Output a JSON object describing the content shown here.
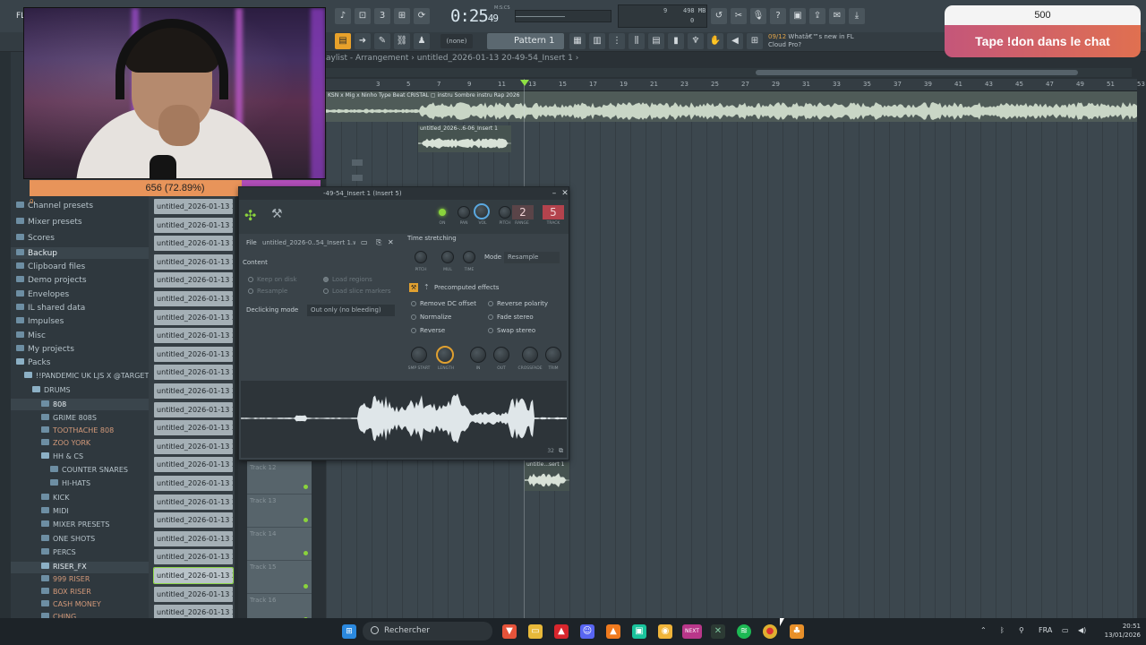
{
  "topbar": {
    "app_label": "FL",
    "time": "0:25",
    "time_small": "49",
    "time_unit": "M:S:CS",
    "cpu": {
      "top_left": "9",
      "top_right": "498 MB",
      "bottom_right": "0"
    },
    "pattern_none": "(none)",
    "pattern": "Pattern 1",
    "news": {
      "date": "09/12",
      "line1": "Whatâ€™s new in FL",
      "line2": "Cloud Pro?"
    }
  },
  "donation": {
    "amount": "500",
    "message": "Tape !don dans le chat"
  },
  "progress": {
    "label": "656 (72.89%)",
    "value": 656,
    "percent": 72.89,
    "min": "0",
    "max": "900"
  },
  "browser": {
    "items": [
      {
        "label": "Channel presets"
      },
      {
        "label": "Mixer presets"
      },
      {
        "label": "Scores"
      },
      {
        "label": "Backup"
      },
      {
        "label": "Clipboard files"
      },
      {
        "label": "Demo projects"
      },
      {
        "label": "Envelopes"
      },
      {
        "label": "IL shared data"
      },
      {
        "label": "Impulses"
      },
      {
        "label": "Misc"
      },
      {
        "label": "My projects"
      },
      {
        "label": "Packs"
      },
      {
        "label": "!!PANDEMIC UK LJS X @TARGETT"
      },
      {
        "label": "DRUMS"
      },
      {
        "label": "808"
      },
      {
        "label": "GRIME 808S"
      },
      {
        "label": "TOOTHACHE 808"
      },
      {
        "label": "ZOO YORK"
      },
      {
        "label": "HH & CS"
      },
      {
        "label": "COUNTER SNARES"
      },
      {
        "label": "HI-HATS"
      },
      {
        "label": "KICK"
      },
      {
        "label": "MIDI"
      },
      {
        "label": "MIXER PRESETS"
      },
      {
        "label": "ONE SHOTS"
      },
      {
        "label": "PERCS"
      },
      {
        "label": "RISER_FX"
      },
      {
        "label": "999 RISER"
      },
      {
        "label": "BOX RISER"
      },
      {
        "label": "CASH MONEY"
      },
      {
        "label": "CHING"
      }
    ],
    "file_item": "untitled_2026-01-13 20-..."
  },
  "playlist": {
    "title": "aylist - Arrangement  ›  untitled_2026-01-13 20-49-54_Insert 1  ›",
    "ruler": [
      "3",
      "5",
      "7",
      "9",
      "11",
      "13",
      "15",
      "17",
      "19",
      "21",
      "23",
      "25",
      "27",
      "29",
      "31",
      "33",
      "35",
      "37",
      "39",
      "41",
      "43",
      "45",
      "47",
      "49",
      "51",
      "53"
    ],
    "clip_main": "KSN x Mig x Ninho Type Beat CRISTAL ▢  instru Sombre  instru Rap 2026",
    "clip_small": "untitled_2026-..6-06_Insert 1",
    "clip_lower": "untitle...sert 1",
    "tracks": [
      "Track 12",
      "Track 13",
      "Track 14",
      "Track 15",
      "Track 16"
    ]
  },
  "channel": {
    "title": "-49-54_Insert 1 (Insert 5)",
    "knobs": {
      "on": "ON",
      "pan": "PAN",
      "vol": "VOL",
      "pitch": "PITCH",
      "range": "RANGE",
      "track": "TRACK"
    },
    "range_value": "2",
    "track_value": "5",
    "file_label": "File",
    "file_value": "untitled_2026-0..54_Insert 1.wav",
    "content_label": "Content",
    "keep_on_disk": "Keep on disk",
    "resample": "Resample",
    "load_regions": "Load regions",
    "load_slice_markers": "Load slice markers",
    "declicking_label": "Declicking mode",
    "declicking_value": "Out only (no bleeding)",
    "time_stretching": "Time stretching",
    "ts_knobs": [
      "PITCH",
      "MUL",
      "TIME"
    ],
    "mode_label": "Mode",
    "mode_value": "Resample",
    "precomputed": "Precomputed effects",
    "effects": [
      "Remove DC offset",
      "Normalize",
      "Reverse",
      "Reverse polarity",
      "Fade stereo",
      "Swap stereo"
    ],
    "bottom_knobs": [
      "SMP START",
      "LENGTH",
      "IN",
      "OUT",
      "CROSSFADE",
      "TRIM"
    ],
    "wave_number": "32"
  },
  "taskbar": {
    "search": "Rechercher",
    "lang": "FRA",
    "time": "20:51",
    "date": "13/01/2026"
  }
}
